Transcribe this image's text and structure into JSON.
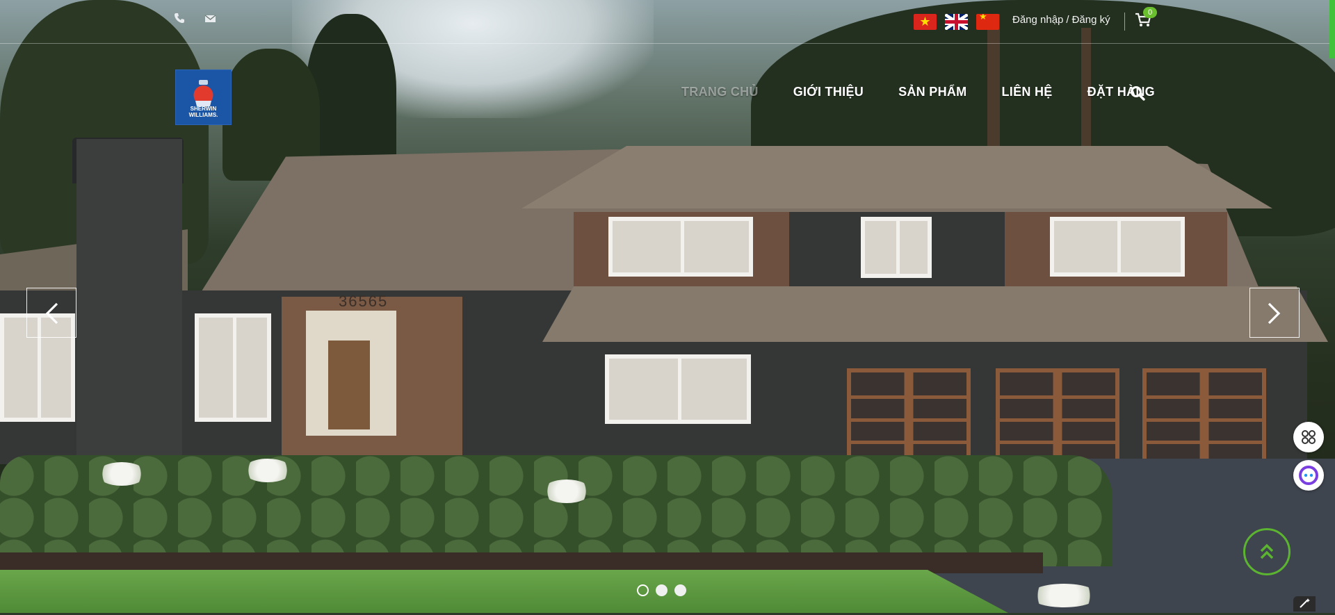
{
  "topbar": {
    "contact_icons": [
      "phone-icon",
      "envelope-icon"
    ],
    "flags": [
      {
        "name": "vietnam-flag",
        "label": "Tiếng Việt"
      },
      {
        "name": "uk-flag",
        "label": "English"
      },
      {
        "name": "china-flag",
        "label": "中文"
      }
    ],
    "login": "Đăng nhập",
    "divider": "/",
    "register": "Đăng ký",
    "cart_count": "0"
  },
  "brand": {
    "logo_text_line1": "SHERWIN",
    "logo_text_line2": "WILLIAMS."
  },
  "nav": {
    "items": [
      {
        "label": "TRANG CHỦ"
      },
      {
        "label": "GIỚI THIỆU"
      },
      {
        "label": "SẢN PHẨM"
      },
      {
        "label": "LIÊN HỆ"
      },
      {
        "label": "ĐẶT HÀNG"
      }
    ]
  },
  "slider": {
    "house_number": "36565",
    "active_index": 0,
    "slide_count": 3
  },
  "colors": {
    "accent": "#5cb531",
    "logo_blue": "#1b56a6",
    "badge": "#6abf2e"
  }
}
